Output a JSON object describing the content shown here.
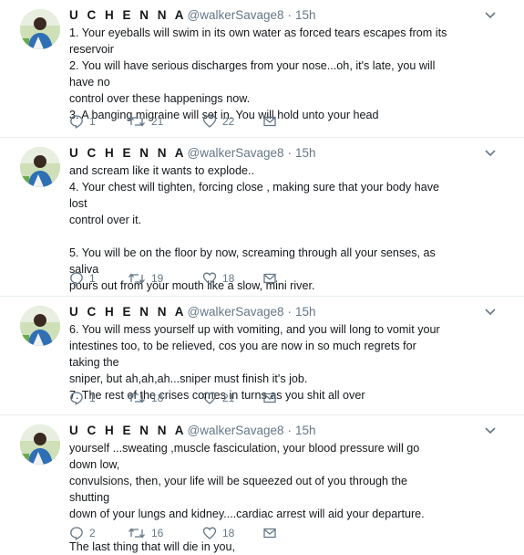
{
  "colors": {
    "text": "#14171a",
    "muted": "#657786",
    "divider": "#e6ecf0"
  },
  "tweets": [
    {
      "name": "U C H E N N A",
      "handle": "@walkerSavage8",
      "time": "15h",
      "lines": [
        "1. Your eyeballs will swim in its own water as forced tears escapes from its",
        "reservoir",
        "2. You will have serious discharges from your nose...oh, it's late, you will have no",
        "control over these happenings now.",
        "3. A banging migraine will set in. You will hold unto your head"
      ],
      "replies": "1",
      "retweets": "21",
      "likes": "22"
    },
    {
      "name": "U C H E N N A",
      "handle": "@walkerSavage8",
      "time": "15h",
      "lines": [
        "and scream like it wants to explode..",
        "4. Your chest will tighten, forcing close , making sure that your body have lost",
        "control over it.",
        "",
        "5. You will be on the floor by now, screaming through all your senses, as saliva",
        "pours out from your mouth like a slow, mini river."
      ],
      "replies": "1",
      "retweets": "19",
      "likes": "18"
    },
    {
      "name": "U C H E N N A",
      "handle": "@walkerSavage8",
      "time": "15h",
      "lines": [
        "6. You will mess yourself up with vomiting, and you will long to vomit your",
        "intestines too, to be relieved, cos you are now in so much regrets for taking the",
        "sniper, but ah,ah,ah...sniper must finish it's job.",
        "7. The rest of the crises comes in turns as you shit all over"
      ],
      "replies": "1",
      "retweets": "18",
      "likes": "21"
    },
    {
      "name": "U C H E N N A",
      "handle": "@walkerSavage8",
      "time": "15h",
      "lines": [
        "yourself ...sweating ,muscle fasciculation, your blood pressure will go down low,",
        "convulsions, then, your life will be squeezed out of you through the shutting",
        "down of your lungs and kidney....cardiac arrest will aid your departure.",
        "",
        "The last thing that will die in you,"
      ],
      "replies": "2",
      "retweets": "16",
      "likes": "18"
    }
  ]
}
